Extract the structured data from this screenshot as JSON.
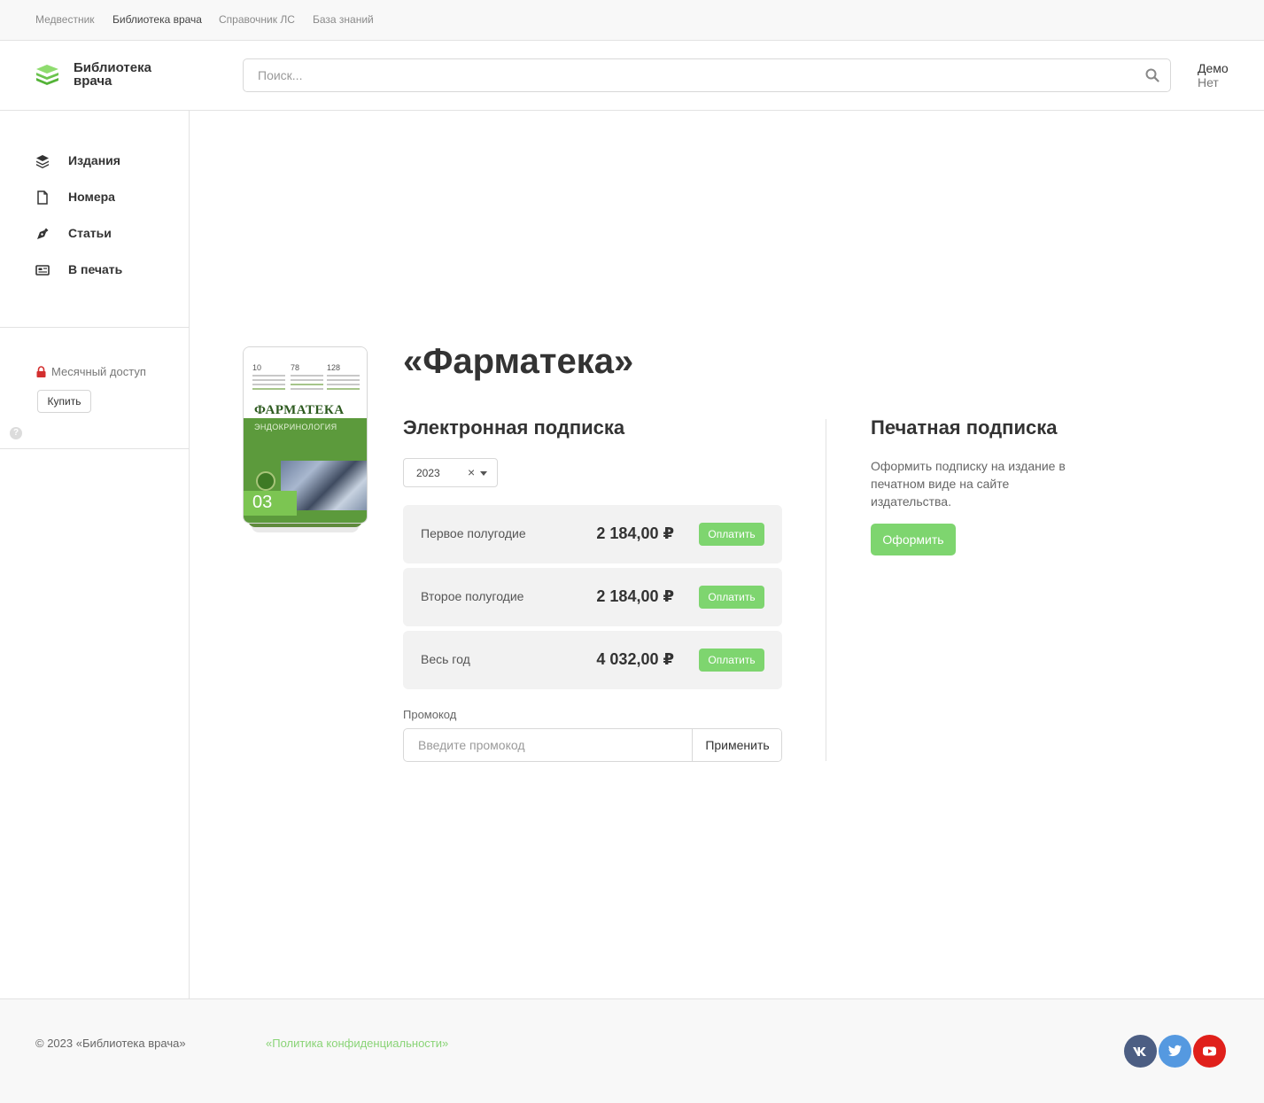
{
  "topnav": {
    "items": [
      {
        "label": "Медвестник"
      },
      {
        "label": "Библиотека врача"
      },
      {
        "label": "Справочник ЛС"
      },
      {
        "label": "База знаний"
      }
    ]
  },
  "header": {
    "logo_line1": "Библиотека",
    "logo_line2": "врача",
    "search_placeholder": "Поиск...",
    "user_name": "Демо",
    "user_sub": "Нет"
  },
  "sidebar": {
    "items": [
      {
        "label": "Издания",
        "icon": "layers-icon"
      },
      {
        "label": "Номера",
        "icon": "file-icon"
      },
      {
        "label": "Статьи",
        "icon": "pen-nib-icon"
      },
      {
        "label": "В печать",
        "icon": "newspaper-icon"
      }
    ],
    "access_label": "Месячный доступ",
    "buy_label": "Купить",
    "help_glyph": "?"
  },
  "cover": {
    "col_numbers": [
      "10",
      "78",
      "128"
    ],
    "title": "ФАРМАТЕКА",
    "subtitle": "ЭНДОКРИНОЛОГИЯ",
    "issue": "03"
  },
  "main": {
    "title": "«Фарматека»",
    "electronic_title": "Электронная подписка",
    "year_value": "2023",
    "clear_glyph": "×",
    "plans": [
      {
        "name": "Первое полугодие",
        "price": "2 184,00 ₽",
        "button": "Оплатить"
      },
      {
        "name": "Второе полугодие",
        "price": "2 184,00 ₽",
        "button": "Оплатить"
      },
      {
        "name": "Весь год",
        "price": "4 032,00 ₽",
        "button": "Оплатить"
      }
    ],
    "promo_label": "Промокод",
    "promo_placeholder": "Введите промокод",
    "promo_button": "Применить",
    "print_title": "Печатная подписка",
    "print_desc": "Оформить подписку на издание в печатном виде на сайте издательства.",
    "print_button": "Оформить"
  },
  "footer": {
    "copyright": "© 2023 «Библиотека врача»",
    "policy": "«Политика конфиденциальности»",
    "social": [
      {
        "name": "vk-icon",
        "color": "#4c5e83"
      },
      {
        "name": "twitter-icon",
        "color": "#5599e0"
      },
      {
        "name": "youtube-icon",
        "color": "#e0201b"
      }
    ]
  },
  "colors": {
    "accent": "#7ed56f",
    "lock": "#d32f2f"
  }
}
